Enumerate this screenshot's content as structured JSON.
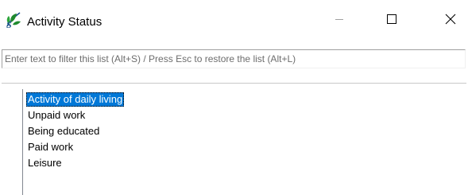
{
  "window": {
    "title": "Activity Status",
    "icon": "app-leaf-logo-icon",
    "controls": {
      "minimize_icon": "minimize-icon",
      "maximize_icon": "maximize-icon",
      "close_icon": "close-icon"
    }
  },
  "filter": {
    "value": "",
    "placeholder": "Enter text to filter this list (Alt+S) / Press Esc to restore the list (Alt+L)"
  },
  "list": {
    "items": [
      {
        "label": "Activity of daily living",
        "selected": true
      },
      {
        "label": "Unpaid work",
        "selected": false
      },
      {
        "label": "Being educated",
        "selected": false
      },
      {
        "label": "Paid work",
        "selected": false
      },
      {
        "label": "Leisure",
        "selected": false
      }
    ]
  },
  "colors": {
    "selection": "#0078d7",
    "logo_green": "#1f8a2e",
    "logo_dark": "#1a4f8a"
  }
}
